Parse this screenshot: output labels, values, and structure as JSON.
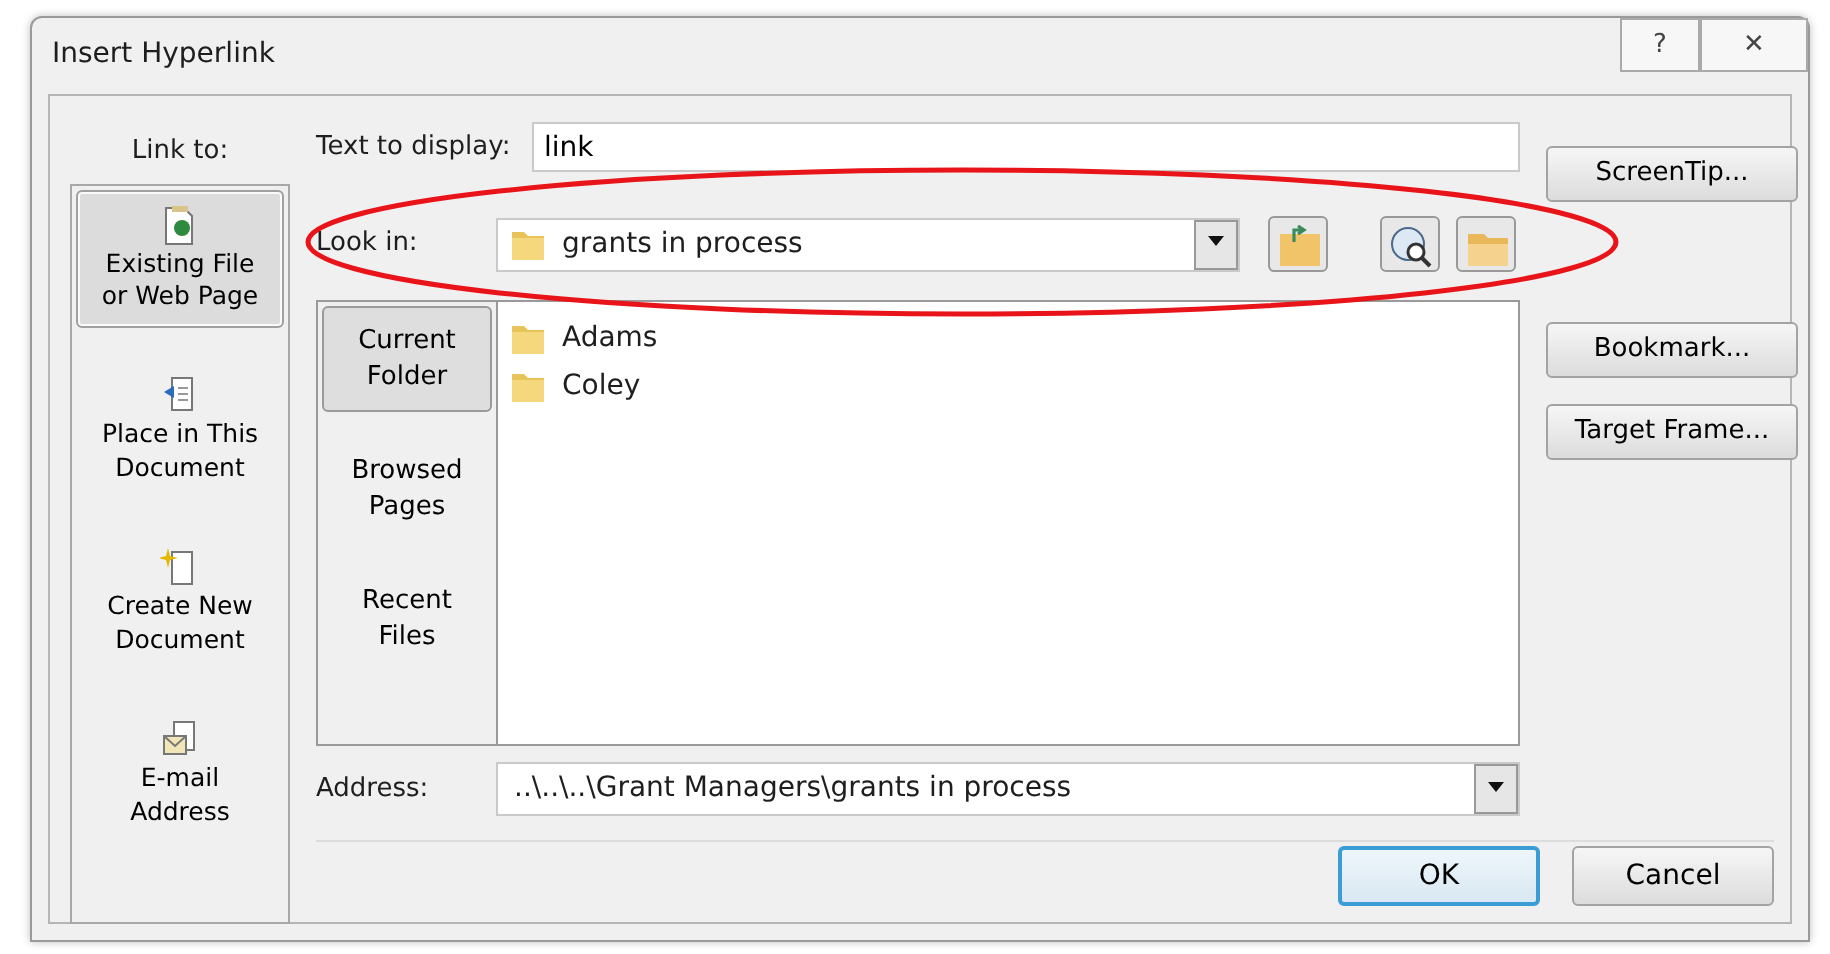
{
  "window": {
    "title": "Insert Hyperlink",
    "buttons": [
      {
        "kind": "help",
        "label": "?"
      },
      {
        "kind": "close",
        "label": "✕"
      }
    ]
  },
  "link_to": {
    "label": "Link to:",
    "items": [
      {
        "kind": "file",
        "label": "Existing File or Web Page",
        "selected": true
      },
      {
        "kind": "place",
        "label": "Place in This Document",
        "selected": false
      },
      {
        "kind": "new",
        "label": "Create New Document",
        "selected": false
      },
      {
        "kind": "mail",
        "label": "E-mail Address",
        "selected": false
      }
    ]
  },
  "text_to_display": {
    "label": "Text to display:",
    "value": "link"
  },
  "look_in": {
    "label": "Look in:",
    "value": "grants in process",
    "tools": [
      {
        "kind": "up"
      },
      {
        "kind": "browse-web"
      },
      {
        "kind": "browse-file"
      }
    ]
  },
  "tabs": [
    {
      "label": "Current Folder",
      "selected": true
    },
    {
      "label": "Browsed Pages",
      "selected": false
    },
    {
      "label": "Recent Files",
      "selected": false
    }
  ],
  "files": [
    {
      "name": "Adams"
    },
    {
      "name": "Coley"
    }
  ],
  "address": {
    "label": "Address:",
    "value": "..\\..\\..\\Grant Managers\\grants in process"
  },
  "side_buttons": [
    "ScreenTip...",
    "Bookmark...",
    "Target Frame..."
  ],
  "footer_buttons": [
    {
      "label": "OK",
      "default": true
    },
    {
      "label": "Cancel",
      "default": false
    }
  ],
  "annotation": {
    "kind": "ellipse"
  }
}
